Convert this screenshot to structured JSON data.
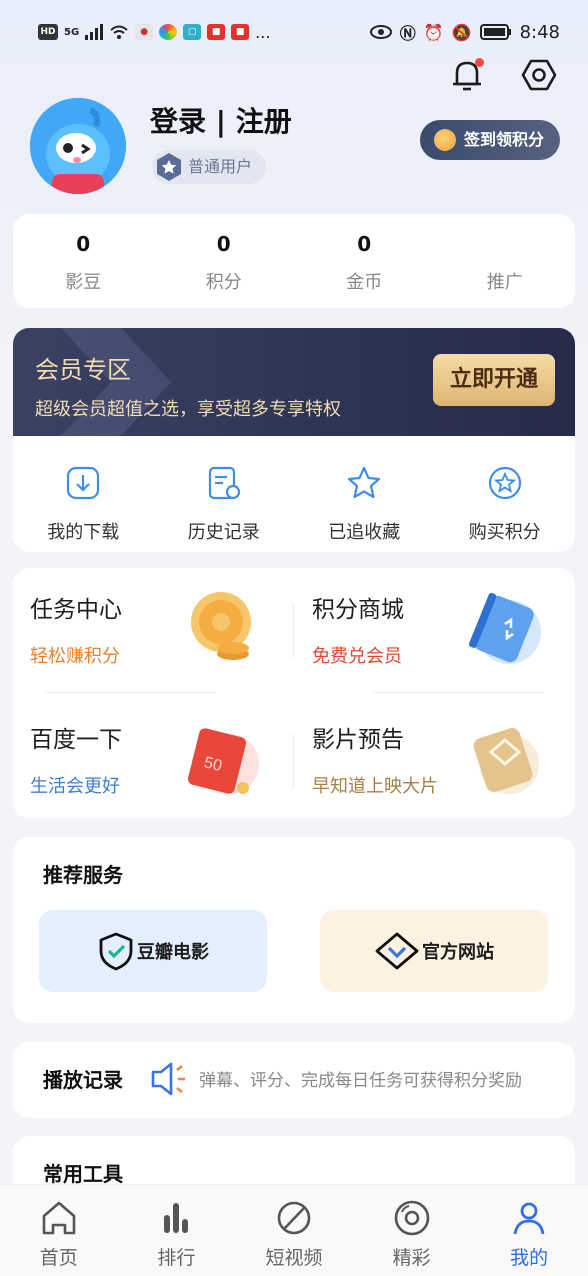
{
  "status_bar": {
    "left_icons": [
      "HD",
      "5G",
      "signal",
      "wifi",
      "app",
      "app",
      "app",
      "app",
      "app",
      "..."
    ],
    "time": "8:48"
  },
  "header": {
    "bell_has_badge": true
  },
  "profile": {
    "login_label": "登录 | 注册",
    "user_level": "普通用户",
    "sign_in_button": "签到领积分"
  },
  "stats": [
    {
      "value": "0",
      "label": "影豆"
    },
    {
      "value": "0",
      "label": "积分"
    },
    {
      "value": "0",
      "label": "金币"
    },
    {
      "value": "",
      "label": "推广"
    }
  ],
  "vip": {
    "title": "会员专区",
    "subtitle": "超级会员超值之选，享受超多专享特权",
    "button": "立即开通"
  },
  "quick_actions": [
    {
      "label": "我的下载",
      "icon": "download-icon"
    },
    {
      "label": "历史记录",
      "icon": "history-icon"
    },
    {
      "label": "已追收藏",
      "icon": "star-icon"
    },
    {
      "label": "购买积分",
      "icon": "star-circle-icon"
    }
  ],
  "tasks": [
    {
      "title": "任务中心",
      "subtitle": "轻松赚积分",
      "color": "#e8812f",
      "icon": "gold-coins-icon"
    },
    {
      "title": "积分商城",
      "subtitle": "免费兑会员",
      "color": "#e0492f",
      "icon": "blue-card-icon"
    },
    {
      "title": "百度一下",
      "subtitle": "生活会更好",
      "color": "#3b7fd4",
      "icon": "red-coupon-icon"
    },
    {
      "title": "影片预告",
      "subtitle": "早知道上映大片",
      "color": "#a58042",
      "icon": "vip-card-icon"
    }
  ],
  "recommended": {
    "title": "推荐服务",
    "items": [
      {
        "label": "豆瓣电影",
        "icon": "shield-check-icon",
        "bg": "#e4effd"
      },
      {
        "label": "官方网站",
        "icon": "diamond-check-icon",
        "bg": "#fcf2e1"
      }
    ]
  },
  "play_record": {
    "title": "播放记录",
    "notice": "弹幕、评分、完成每日任务可获得积分奖励"
  },
  "tools": {
    "title": "常用工具"
  },
  "tabbar": [
    {
      "label": "首页",
      "icon": "home-icon",
      "active": false
    },
    {
      "label": "排行",
      "icon": "bars-icon",
      "active": false
    },
    {
      "label": "短视频",
      "icon": "leaf-icon",
      "active": false
    },
    {
      "label": "精彩",
      "icon": "disc-icon",
      "active": false
    },
    {
      "label": "我的",
      "icon": "person-icon",
      "active": true
    }
  ]
}
